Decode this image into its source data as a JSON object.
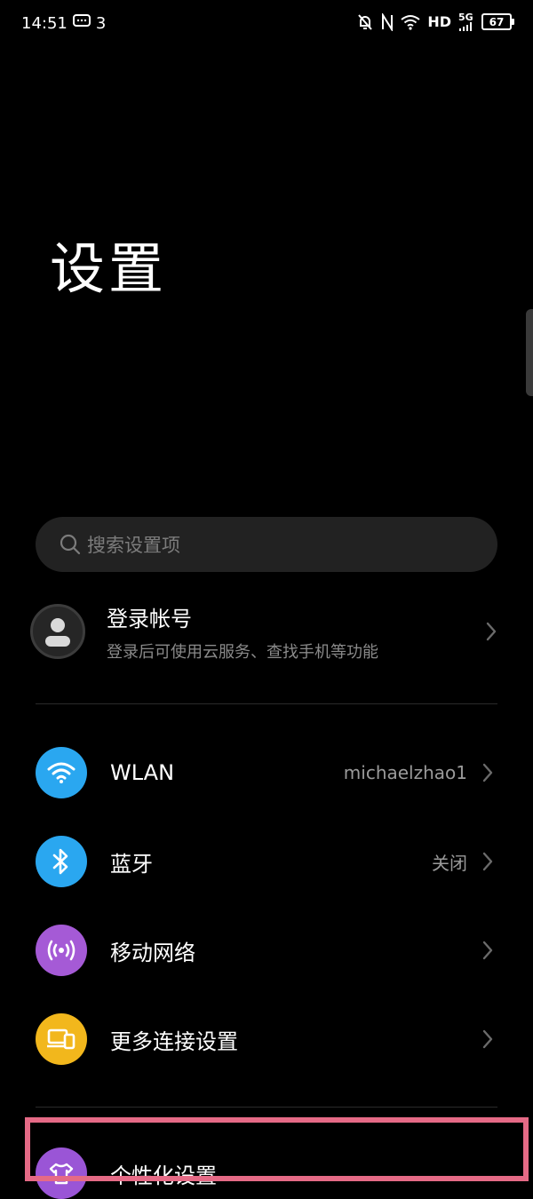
{
  "status_bar": {
    "time": "14:51",
    "notification_count": "3",
    "hd_label": "HD",
    "network_label": "5G",
    "battery": "67"
  },
  "page": {
    "title": "设置"
  },
  "search": {
    "placeholder": "搜索设置项"
  },
  "account": {
    "title": "登录帐号",
    "subtitle": "登录后可使用云服务、查找手机等功能"
  },
  "rows": [
    {
      "label": "WLAN",
      "value": "michaelzhao1",
      "icon": "wifi-icon",
      "color": "#2aa7f0"
    },
    {
      "label": "蓝牙",
      "value": "关闭",
      "icon": "bluetooth-icon",
      "color": "#2aa7f0"
    },
    {
      "label": "移动网络",
      "value": "",
      "icon": "mobile-network-icon",
      "color": "#a55ad6"
    },
    {
      "label": "更多连接设置",
      "value": "",
      "icon": "more-connections-icon",
      "color": "#f2b71c"
    },
    {
      "label": "个性化设置",
      "value": "",
      "icon": "personalization-icon",
      "color": "#9a55d6"
    }
  ],
  "colors": {
    "background": "#000000",
    "search_bg": "#222222",
    "highlight_box": "#e56a86"
  }
}
